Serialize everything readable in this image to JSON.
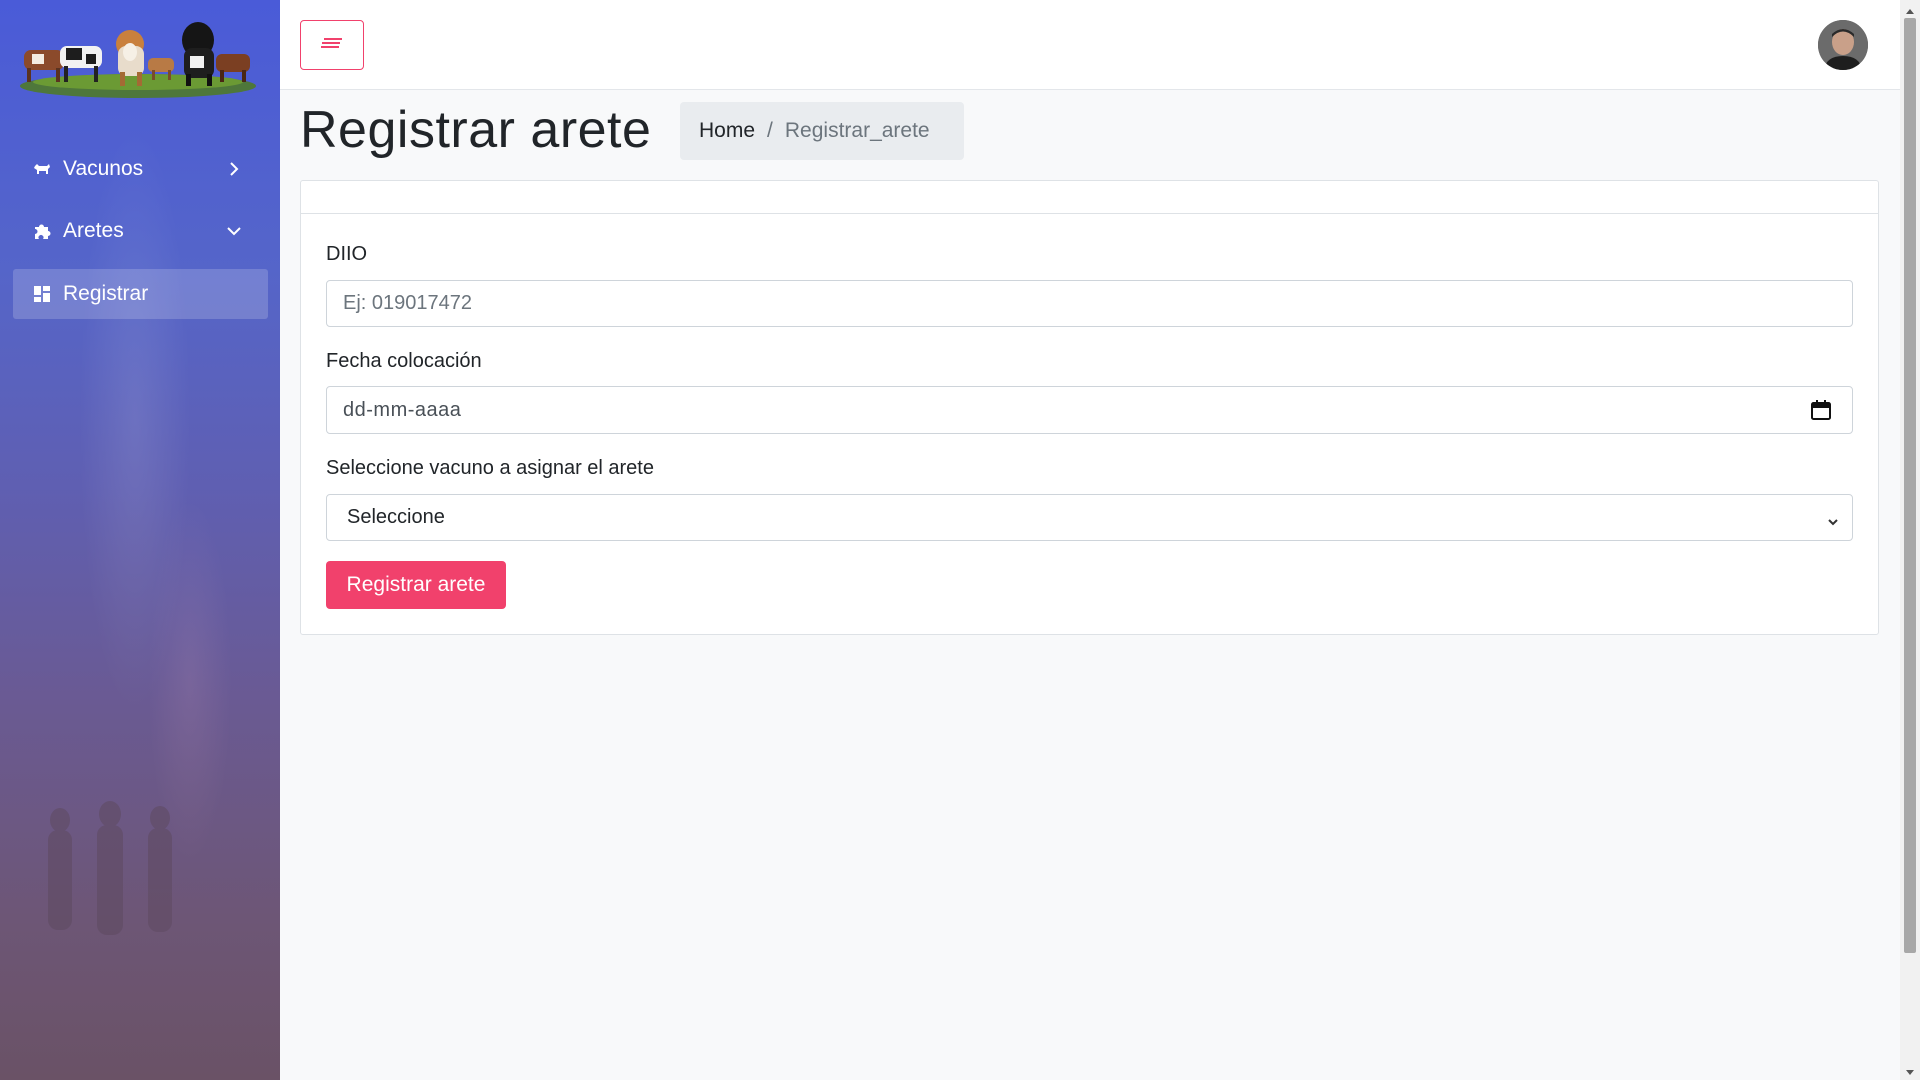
{
  "sidebar": {
    "items": [
      {
        "label": "Vacunos",
        "icon": "cow-icon",
        "chevron": "chevron-right-icon"
      },
      {
        "label": "Aretes",
        "icon": "puzzle-icon",
        "chevron": "chevron-down-icon"
      },
      {
        "label": "Registrar",
        "icon": "grid-icon",
        "active": true
      }
    ]
  },
  "page": {
    "title": "Registrar arete",
    "breadcrumb": {
      "home": "Home",
      "separator": "/",
      "current": "Registrar_arete"
    }
  },
  "form": {
    "diio_label": "DIIO",
    "diio_placeholder": "Ej: 019017472",
    "fecha_label": "Fecha colocación",
    "fecha_placeholder": "dd-mm-aaaa",
    "vacuno_label": "Seleccione vacuno a asignar el arete",
    "vacuno_selected": "Seleccione",
    "submit_label": "Registrar arete"
  },
  "colors": {
    "accent": "#f1416c",
    "sidebar_top": "#4a5bd8",
    "sidebar_bottom": "#6a5266",
    "background": "#f8f9fa"
  }
}
